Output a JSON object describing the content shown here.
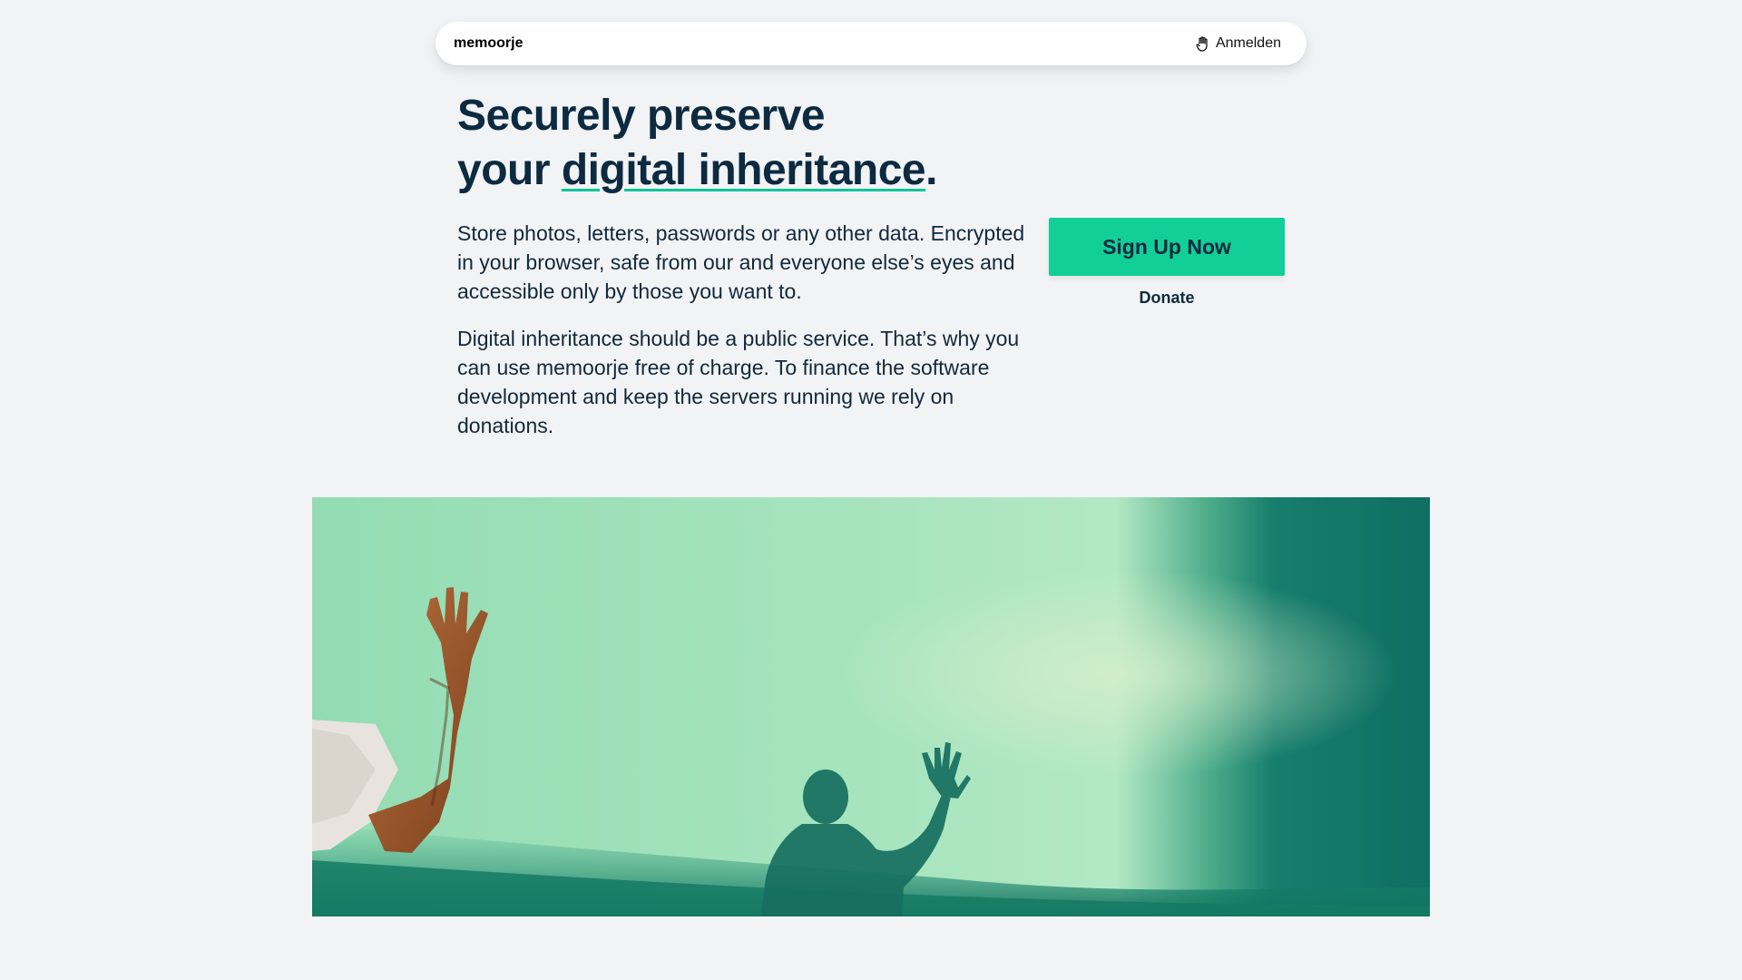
{
  "header": {
    "brand": "memoorje",
    "login_label": "Anmelden",
    "login_icon": "hand-icon"
  },
  "hero": {
    "headline_line1": "Securely preserve",
    "headline_line2_prefix": "your ",
    "headline_highlight": "digital inheritance",
    "headline_suffix": ".",
    "paragraph1": "Store photos, letters, passwords or any other data. Encrypted in your browser, safe from our and everyone else’s eyes and accessible only by those you want to.",
    "paragraph2": "Digital inheritance should be a public service. That’s why you can use memoorje free of charge. To finance the software development and keep the servers running we rely on donations."
  },
  "cta": {
    "signup_label": "Sign Up Now",
    "donate_label": "Donate"
  },
  "colors": {
    "accent": "#12cf97",
    "text": "#0c2a40",
    "background": "#f2f3f5"
  }
}
